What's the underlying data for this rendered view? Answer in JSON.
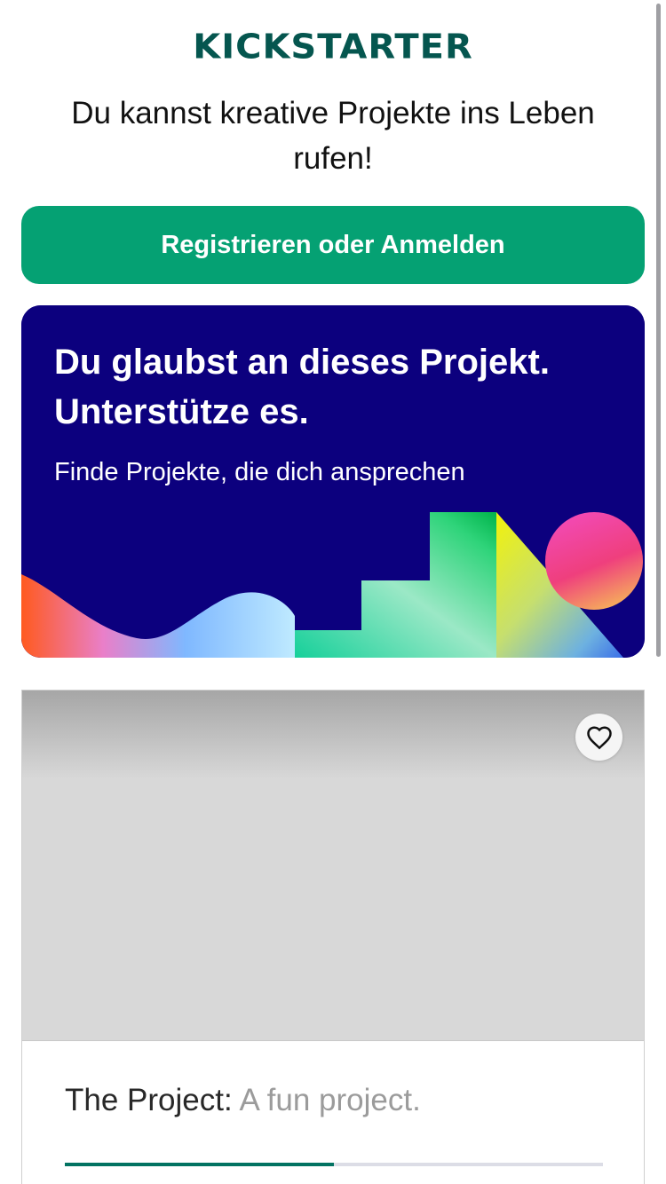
{
  "brand": {
    "logo_text": "KICKSTARTER",
    "color": "#05564f"
  },
  "header": {
    "tagline": "Du kannst kreative Projekte ins Leben rufen!"
  },
  "signup_button": {
    "label": "Registrieren oder Anmelden",
    "color": "#05a173"
  },
  "promo": {
    "headline": "Du glaubst an dieses Projekt. Unterstütze es.",
    "subtitle": "Finde Projekte, die dich ansprechen",
    "background_color": "#0c007e"
  },
  "project_card": {
    "name": "The Project:",
    "blurb": "A fun project.",
    "favorite_icon": "heart-outline-icon",
    "funding_progress": 0.5,
    "progress_color": "#037362"
  }
}
